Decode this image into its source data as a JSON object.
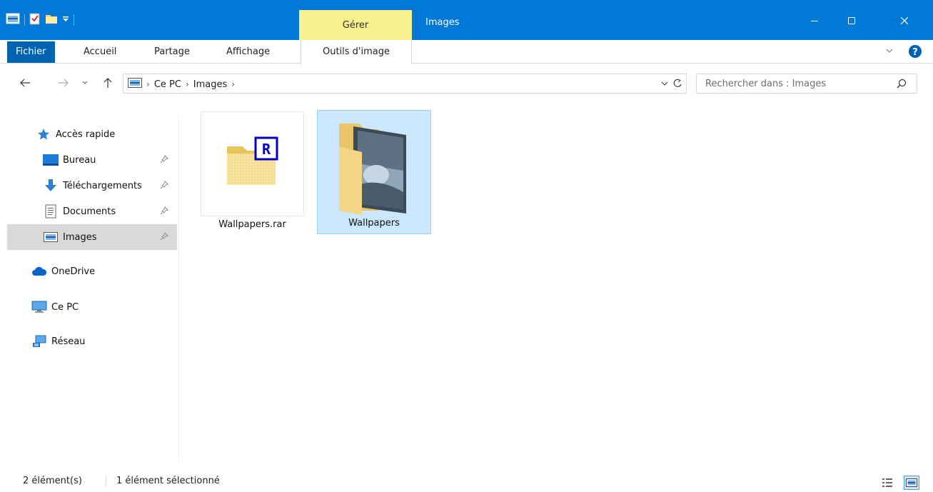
{
  "window": {
    "context_tab_label": "Gérer",
    "title": "Images",
    "controls": [
      "minimize",
      "maximize",
      "close"
    ]
  },
  "ribbon": {
    "tabs": [
      {
        "label": "Fichier"
      },
      {
        "label": "Accueil"
      },
      {
        "label": "Partage"
      },
      {
        "label": "Affichage"
      },
      {
        "label": "Outils d'image"
      }
    ]
  },
  "address": {
    "breadcrumbs": [
      "Ce PC",
      "Images"
    ],
    "search_placeholder": "Rechercher dans : Images"
  },
  "navpane": {
    "items": [
      {
        "label": "Accès rapide",
        "icon": "star-icon"
      },
      {
        "label": "Bureau",
        "icon": "desktop-icon",
        "pinned": true
      },
      {
        "label": "Téléchargements",
        "icon": "download-icon",
        "pinned": true
      },
      {
        "label": "Documents",
        "icon": "documents-icon",
        "pinned": true
      },
      {
        "label": "Images",
        "icon": "pictures-icon",
        "pinned": true,
        "selected": true
      },
      {
        "label": "OneDrive",
        "icon": "cloud-icon"
      },
      {
        "label": "Ce PC",
        "icon": "computer-icon"
      },
      {
        "label": "Réseau",
        "icon": "network-icon"
      }
    ]
  },
  "files": [
    {
      "name": "Wallpapers.rar",
      "icon": "winrar-archive-icon"
    },
    {
      "name": "Wallpapers",
      "icon": "folder-icon",
      "selected": true
    }
  ],
  "status": {
    "count": "2 élément(s)",
    "selection": "1 élément sélectionné"
  },
  "colors": {
    "titlebar": "#0078d7",
    "context_tab": "#f7f08f",
    "file_tab": "#0063b1",
    "selection": "#cce8ff",
    "nav_selected": "#d9d9d9"
  }
}
